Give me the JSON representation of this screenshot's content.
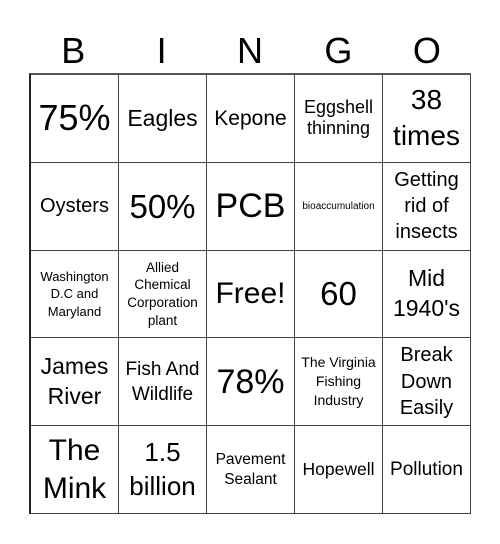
{
  "header": {
    "letters": [
      "B",
      "I",
      "N",
      "G",
      "O"
    ]
  },
  "cells": [
    [
      "75%",
      "Eagles",
      "Kepone",
      "Eggshell thinning",
      "38 times"
    ],
    [
      "Oysters",
      "50%",
      "PCB",
      "bioaccumulation",
      "Getting rid of insects"
    ],
    [
      "Washington D.C and Maryland",
      "Allied Chemical Corporation plant",
      "Free!",
      "60",
      "Mid 1940's"
    ],
    [
      "James River",
      "Fish And Wildlife",
      "78%",
      "The Virginia Fishing Industry",
      "Break Down Easily"
    ],
    [
      "The Mink",
      "1.5 billion",
      "Pavement Sealant",
      "Hopewell",
      "Pollution"
    ]
  ],
  "free_space": "Free!"
}
